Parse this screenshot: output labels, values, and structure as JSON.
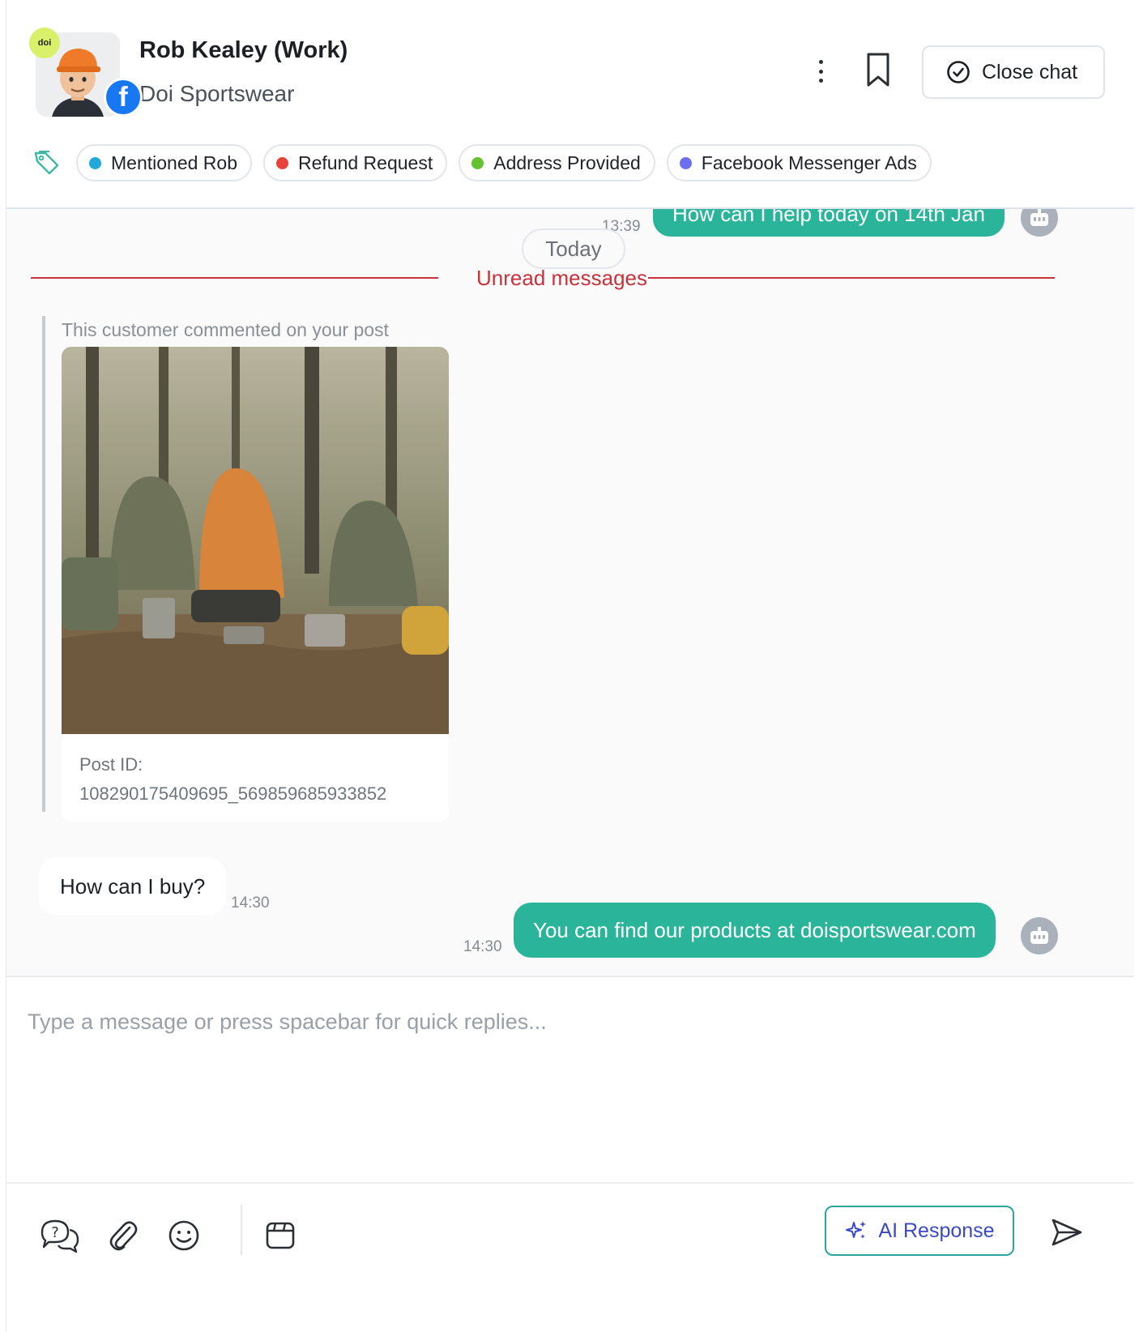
{
  "header": {
    "name": "Rob Kealey (Work)",
    "company": "Doi Sportswear",
    "brand_badge": "doi",
    "close_label": "Close chat"
  },
  "tags": [
    {
      "label": "Mentioned Rob",
      "color": "#1fa8d8"
    },
    {
      "label": "Refund Request",
      "color": "#e8423a"
    },
    {
      "label": "Address Provided",
      "color": "#62c22f"
    },
    {
      "label": "Facebook Messenger Ads",
      "color": "#6b6ff0"
    }
  ],
  "conversation": {
    "previous_message": {
      "text": "How can I help today on 14th Jan",
      "time": "13:39"
    },
    "today_label": "Today",
    "unread_label": "Unread messages",
    "post": {
      "caption": "This customer commented on your post",
      "id_label": "Post ID:",
      "id_value": "108290175409695_569859685933852"
    },
    "customer_message": {
      "text": "How can I buy?",
      "time": "14:30"
    },
    "bot_reply": {
      "text": "You can find our products at doisportswear.com",
      "time": "14:30"
    }
  },
  "composer": {
    "placeholder": "Type a message or press spacebar for quick replies...",
    "ai_label": "AI Response"
  },
  "colors": {
    "accent_green": "#2ab49a",
    "unread_red": "#c8323c",
    "ai_blue": "#3b49c4"
  },
  "icons": [
    "more-vertical-icon",
    "bookmark-icon",
    "check-circle-icon",
    "tag-icon",
    "bot-icon",
    "quick-reply-icon",
    "paperclip-icon",
    "emoji-icon",
    "template-icon",
    "sparkle-icon",
    "send-icon"
  ]
}
